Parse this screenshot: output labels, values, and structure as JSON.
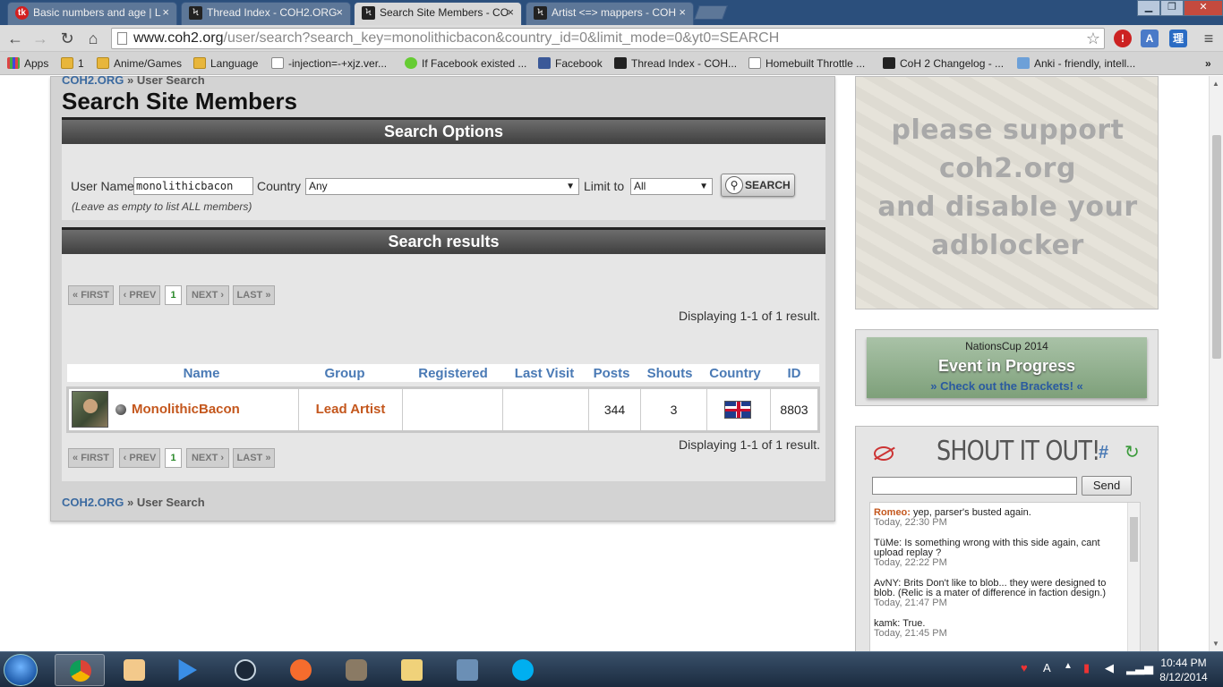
{
  "browser": {
    "tabs": [
      {
        "title": "Basic numbers and age | L",
        "icon": "tk"
      },
      {
        "title": "Thread Index - COH2.ORG",
        "icon": "coh2-icon"
      },
      {
        "title": "Search Site Members - CO",
        "icon": "coh2-icon"
      },
      {
        "title": "Artist <=> mappers - COH",
        "icon": "coh2-icon"
      }
    ],
    "url_host": "www.coh2.org",
    "url_path": "/user/search?search_key=monolithicbacon&country_id=0&limit_mode=0&yt0=SEARCH",
    "bookmarks": [
      {
        "label": "Apps",
        "icon": "apps"
      },
      {
        "label": "1",
        "icon": "folder"
      },
      {
        "label": "Anime/Games",
        "icon": "folder"
      },
      {
        "label": "Language",
        "icon": "folder"
      },
      {
        "label": "-injection=-+xjz.ver...",
        "icon": "page"
      },
      {
        "label": "If Facebook existed ...",
        "icon": "green"
      },
      {
        "label": "Facebook",
        "icon": "fb"
      },
      {
        "label": "Thread Index - COH...",
        "icon": "coh"
      },
      {
        "label": "Homebuilt Throttle ...",
        "icon": "page"
      },
      {
        "label": "CoH 2 Changelog - ...",
        "icon": "coh"
      },
      {
        "label": "Anki - friendly, intell...",
        "icon": "anki"
      }
    ]
  },
  "page": {
    "breadcrumb_home": "COH2.ORG",
    "breadcrumb_sep": "»",
    "breadcrumb_current": "User Search",
    "title": "Search Site Members",
    "search_options_header": "Search Options",
    "form": {
      "username_label": "User Name",
      "username_value": "monolithicbacon",
      "country_label": "Country",
      "country_value": "Any",
      "limit_label": "Limit to",
      "limit_value": "All",
      "hint": "(Leave as empty to list ALL members)",
      "search_button": "SEARCH"
    },
    "results_header": "Search results",
    "pager": {
      "first": "« FIRST",
      "prev": "‹ PREV",
      "current": "1",
      "next": "NEXT ›",
      "last": "LAST »"
    },
    "result_count": "Displaying 1-1 of 1 result.",
    "columns": [
      "Name",
      "Group",
      "Registered",
      "Last Visit",
      "Posts",
      "Shouts",
      "Country",
      "ID"
    ],
    "row": {
      "name": "MonolithicBacon",
      "group": "Lead Artist",
      "registered": "",
      "last_visit": "",
      "posts": "344",
      "shouts": "3",
      "country_flag": "uk-flag",
      "id": "8803"
    }
  },
  "sidebar": {
    "ad_lines": [
      "please support",
      "coh2.org",
      "and disable your",
      "adblocker"
    ],
    "nations_title": "NationsCup 2014",
    "nations_status": "Event in Progress",
    "nations_link": "» Check out the Brackets! «",
    "shout_title": "SHOUT IT OUT!",
    "shout_hash": "#",
    "send_label": "Send",
    "messages": [
      {
        "user": "Romeo:",
        "text": " yep, parser's busted again.",
        "time": "Today, 22:30 PM",
        "highlight": true
      },
      {
        "user": "TüMe:",
        "text": " Is something wrong with this side again, cant upload replay ?",
        "time": "Today, 22:22 PM",
        "highlight": false
      },
      {
        "user": "AvNY:",
        "text": " Brits Don't like to blob... they were designed to blob. (Relic is a mater of difference in faction design.)",
        "time": "Today, 21:47 PM",
        "highlight": false
      },
      {
        "user": "kamk:",
        "text": " True.",
        "time": "Today, 21:45 PM",
        "highlight": false
      }
    ]
  },
  "taskbar": {
    "time": "10:44 PM",
    "date": "8/12/2014"
  }
}
